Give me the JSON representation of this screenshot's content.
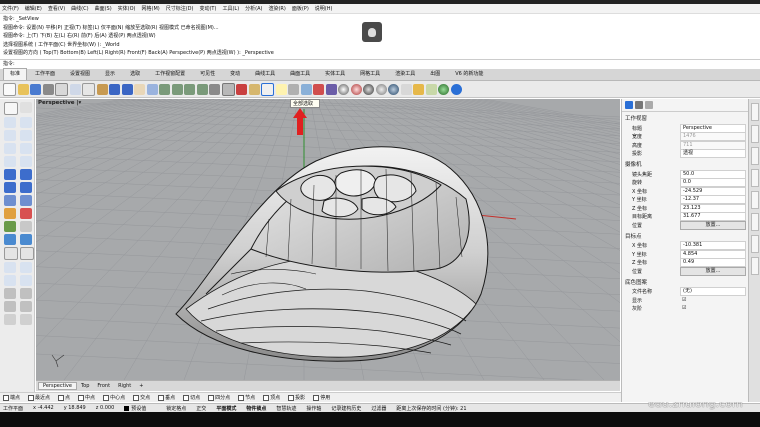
{
  "menu": [
    "文件(F)",
    "编辑(E)",
    "查看(V)",
    "曲线(C)",
    "曲面(S)",
    "实体(O)",
    "网格(M)",
    "尺寸标注(D)",
    "变动(T)",
    "工具(L)",
    "分析(A)",
    "渲染(R)",
    "面板(P)",
    "说明(H)"
  ],
  "command_history": [
    "指令: _SetView",
    "视图命令: 设置(N) 平移(P) 正视(T) 标签(L) 仅平面(N) 缩放至选取(R) 视图模式 已命名视图(M)...",
    "视图命令: 上(T) 下(B) 左(L) 右(R) 前(F) 后(A) 透视(P) 两点透视(W)",
    "选择视图系统 ( 工作平面(C) 世界坐标(W) ): _World",
    "设置视图的方向 ( Top(T) Bottom(B) Left(L) Right(R) Front(F) Back(A) Perspective(P) 两点透视(W) ): _Perspective"
  ],
  "command_prompt": "指令:",
  "tabs": [
    "标准",
    "工作平面",
    "设置视图",
    "显示",
    "选取",
    "工作视窗配置",
    "可见性",
    "变动",
    "曲线工具",
    "曲面工具",
    "实体工具",
    "网格工具",
    "渲染工具",
    "出图",
    "V6 的新功能"
  ],
  "active_tab": "标准",
  "tooltip": "全部选取",
  "viewport": {
    "title": "Perspective",
    "arrow": "|▾"
  },
  "viewport_tabs": [
    "Perspective",
    "Top",
    "Front",
    "Right",
    "+"
  ],
  "osnaps": [
    "端点",
    "最近点",
    "点",
    "中点",
    "中心点",
    "交点",
    "垂点",
    "切点",
    "四分点",
    "节点",
    "顶点",
    "投影",
    "停用"
  ],
  "status": {
    "cplane": "工作平面",
    "x": "x -4.442",
    "y": "y 18.849",
    "z": "z 0.000",
    "layer": "预设值",
    "items": [
      "锁定格点",
      "正交",
      "平面模式",
      "物件锁点",
      "智慧轨迹",
      "操作轴",
      "记录建构历史",
      "过滤器",
      "距离上次保存的时间 (分钟): 21"
    ]
  },
  "panel": {
    "section1": "工作视窗",
    "rows1": [
      {
        "k": "标题",
        "v": "Perspective",
        "grey": false
      },
      {
        "k": "宽度",
        "v": "1476",
        "grey": true
      },
      {
        "k": "高度",
        "v": "711",
        "grey": true
      },
      {
        "k": "投影",
        "v": "透视",
        "grey": false
      }
    ],
    "section2": "摄像机",
    "rows2": [
      {
        "k": "镜头焦距",
        "v": "50.0"
      },
      {
        "k": "旋转",
        "v": "0.0"
      },
      {
        "k": "X 坐标",
        "v": "-24.529"
      },
      {
        "k": "Y 坐标",
        "v": "-12.37"
      },
      {
        "k": "Z 坐标",
        "v": "23.123"
      },
      {
        "k": "目标距离",
        "v": "31.677"
      },
      {
        "k": "位置",
        "v": "放置..."
      }
    ],
    "section3": "目标点",
    "rows3": [
      {
        "k": "X 坐标",
        "v": "-10.381"
      },
      {
        "k": "Y 坐标",
        "v": "4.854"
      },
      {
        "k": "Z 坐标",
        "v": "0.49"
      },
      {
        "k": "位置",
        "v": "放置..."
      }
    ],
    "section4": "底色图案",
    "rows4": [
      {
        "k": "文件名称",
        "v": "(无)"
      },
      {
        "k": "显示",
        "v": "☑"
      },
      {
        "k": "灰阶",
        "v": "☑"
      }
    ]
  },
  "watermark": "edu.zhulong.com",
  "colors": {
    "accent": "#2a6fd6",
    "grid": "#8e9094",
    "x_axis": "#c4302b",
    "y_axis": "#2f8f2f",
    "arrow": "#e02020"
  }
}
